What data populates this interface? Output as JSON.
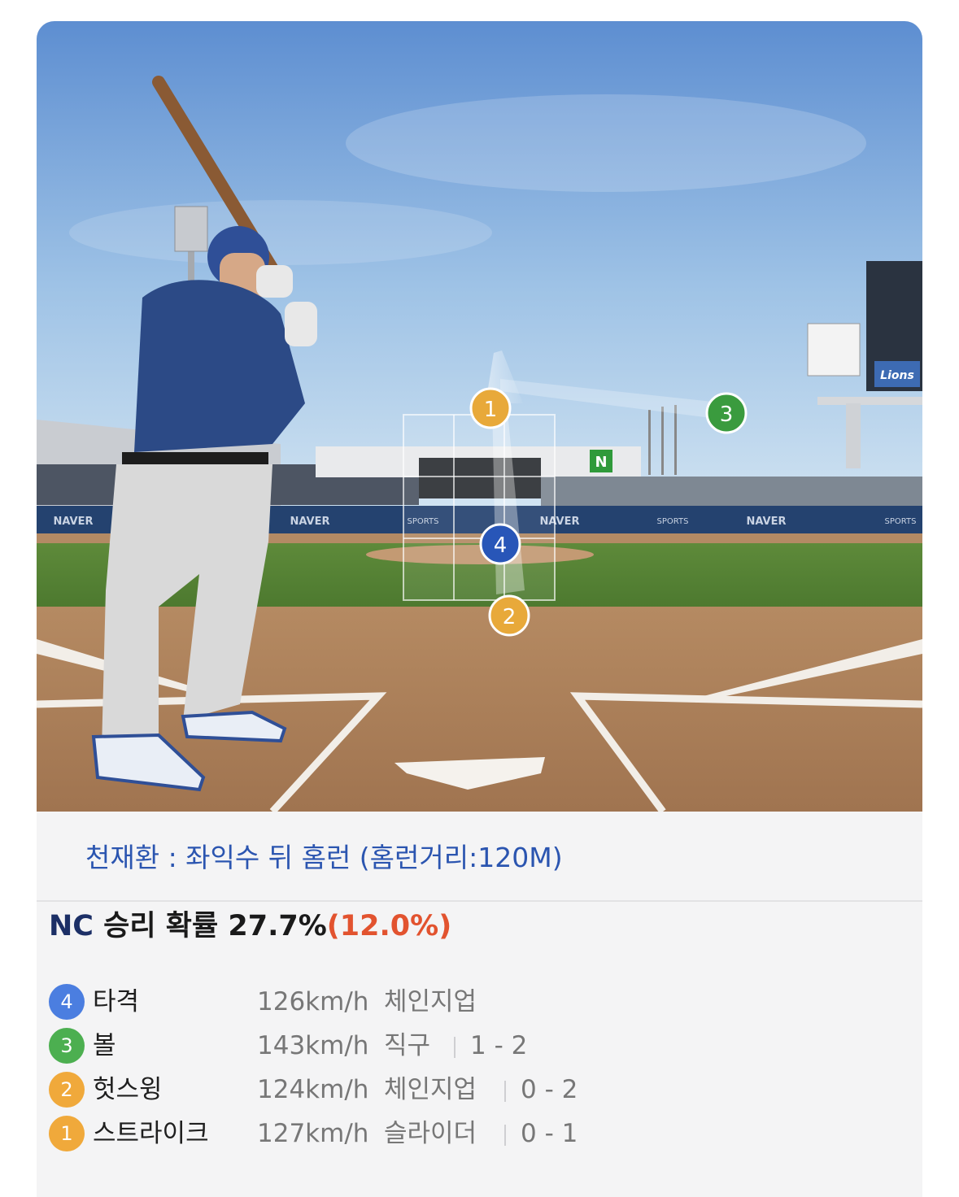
{
  "scene": {
    "banner_text": "NAVER",
    "banner_sports_text": "SPORTS",
    "scoreboard_logo": "Lions",
    "wall_letter": "N",
    "markers": [
      {
        "number": "1",
        "color": "#e8a93a"
      },
      {
        "number": "2",
        "color": "#e8a93a"
      },
      {
        "number": "3",
        "color": "#3a9b3e"
      },
      {
        "number": "4",
        "color": "#2856b8"
      }
    ]
  },
  "result_text": "천재환 : 좌익수 뒤 홈런 (홈런거리:120M)",
  "win_probability": {
    "team": "NC",
    "label": "승리 확률",
    "value": "27.7%",
    "delta": "(12.0%)"
  },
  "pitches": [
    {
      "number": "4",
      "color": "#4b7ee0",
      "result": "타격",
      "speed": "126km/h",
      "type": "체인지업",
      "count": ""
    },
    {
      "number": "3",
      "color": "#4caf50",
      "result": "볼",
      "speed": "143km/h",
      "type": "직구",
      "count": "1 - 2"
    },
    {
      "number": "2",
      "color": "#f0a93b",
      "result": "헛스윙",
      "speed": "124km/h",
      "type": "체인지업",
      "count": "0 - 2"
    },
    {
      "number": "1",
      "color": "#f0a93b",
      "result": "스트라이크",
      "speed": "127km/h",
      "type": "슬라이더",
      "count": "0 - 1"
    }
  ]
}
